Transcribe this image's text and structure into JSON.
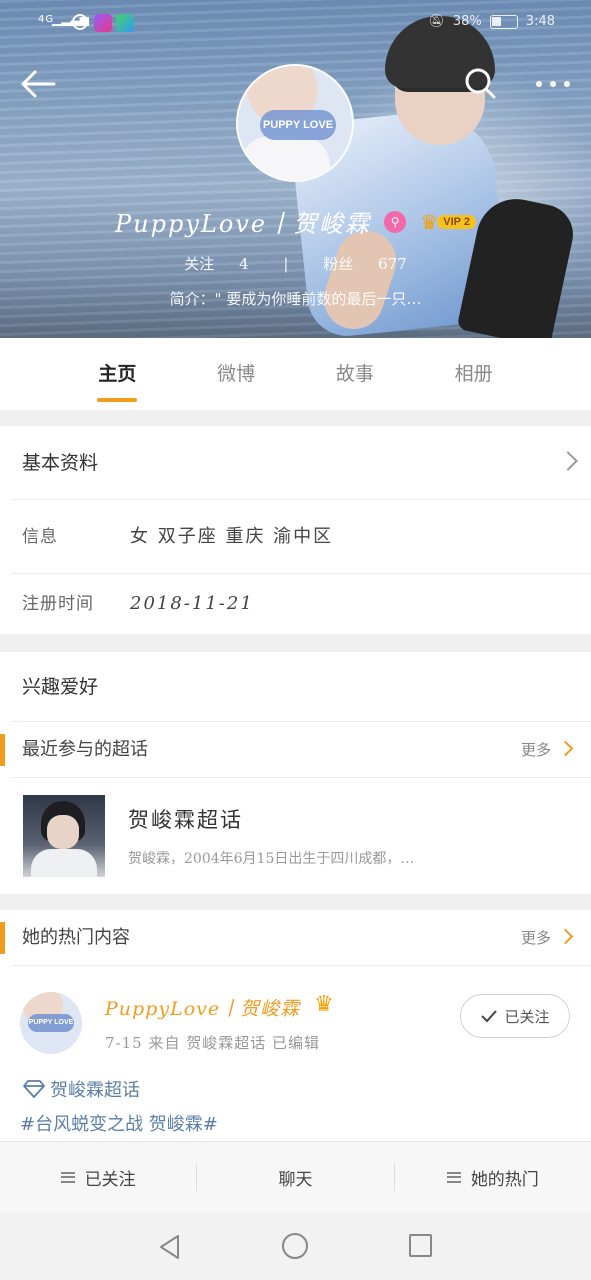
{
  "status_bar": {
    "network": "4G",
    "battery": "38%",
    "time": "3:48"
  },
  "profile": {
    "name": "PuppyLove丨贺峻霖",
    "avatar_text": "PUPPY LOVE",
    "vip_label": "VIP 2",
    "follow_label": "关注",
    "follow_count": "4",
    "separator": "|",
    "fans_label": "粉丝",
    "fans_count": "677",
    "bio": "简介：\" 要成为你睡前数的最后一只…"
  },
  "tabs": [
    {
      "label": "主页",
      "active": true
    },
    {
      "label": "微博",
      "active": false
    },
    {
      "label": "故事",
      "active": false
    },
    {
      "label": "相册",
      "active": false
    }
  ],
  "basic_info": {
    "title": "基本资料",
    "info_label": "信息",
    "info_value": "女  双子座  重庆 渝中区",
    "reg_label": "注册时间",
    "reg_value": "2018-11-21"
  },
  "interests": {
    "title": "兴趣爱好",
    "section_title": "最近参与的超话",
    "more_label": "更多",
    "topic_title": "贺峻霖超话",
    "topic_desc": "贺峻霖，2004年6月15日出生于四川成都，…"
  },
  "hot": {
    "section_title": "她的热门内容",
    "more_label": "更多",
    "post_author": "PuppyLove丨贺峻霖",
    "post_meta": "7-15  来自 贺峻霖超话  已编辑",
    "followed_label": "已关注",
    "link1": "贺峻霖超话",
    "link2": "#台风蜕变之战 贺峻霖#"
  },
  "bottom_bar": {
    "followed": "已关注",
    "chat": "聊天",
    "hot": "她的热门"
  },
  "colors": {
    "accent": "#f29c1f",
    "link": "#5b7fa8",
    "vip": "#f7c21d"
  }
}
